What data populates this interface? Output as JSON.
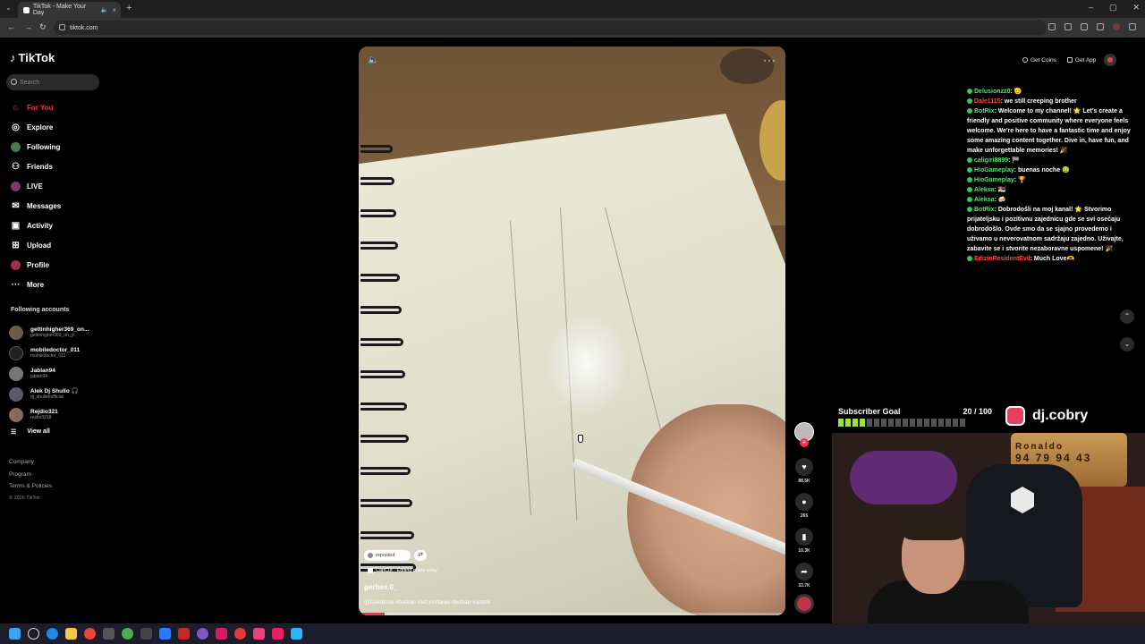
{
  "browser": {
    "tab_title": "TikTok - Make Your Day",
    "url": "tiktok.com"
  },
  "sidebar": {
    "logo": "TikTok",
    "search_placeholder": "Search",
    "nav": [
      {
        "label": "For You",
        "icon": "home-icon",
        "active": true
      },
      {
        "label": "Explore",
        "icon": "compass-icon"
      },
      {
        "label": "Following",
        "icon": "following-icon"
      },
      {
        "label": "Friends",
        "icon": "friends-icon"
      },
      {
        "label": "LIVE",
        "icon": "live-icon"
      },
      {
        "label": "Messages",
        "icon": "message-icon"
      },
      {
        "label": "Activity",
        "icon": "activity-icon"
      },
      {
        "label": "Upload",
        "icon": "upload-icon"
      },
      {
        "label": "Profile",
        "icon": "profile-icon"
      },
      {
        "label": "More",
        "icon": "more-icon"
      }
    ],
    "following_title": "Following accounts",
    "accounts": [
      {
        "name": "gettinhigher369_on...",
        "handle": "gettinhigher369_on_yt"
      },
      {
        "name": "mobiledoctor_011",
        "handle": "mobiledoctor_011"
      },
      {
        "name": "Jablan94",
        "handle": "jablan94"
      },
      {
        "name": "Alek Dj Shullo 🎧",
        "handle": "dj_shulleeofficial"
      },
      {
        "name": "Rejdio321",
        "handle": "rejdio3218"
      }
    ],
    "view_all": "View all",
    "footer": {
      "company": "Company",
      "program": "Program",
      "terms": "Terms & Policies",
      "copyright": "© 2026 TikTok"
    }
  },
  "video": {
    "repost_label": "reposted",
    "capcut_label": "CapCut · Editing made easy",
    "author": "gerbes.0_",
    "caption": "@Dekibmw #balkan #art #crtanje #boban #arttok",
    "progress": 0.06
  },
  "actions": {
    "likes": "88.5K",
    "comments": "265",
    "saves": "10.3K",
    "shares": "33.7K"
  },
  "topbar": {
    "get_coins": "Get Coins",
    "get_app": "Get App"
  },
  "chat": [
    {
      "user": "Delusionzz0",
      "text": ": 🫡",
      "color": "green"
    },
    {
      "user": "Dale1115",
      "text": ": we still creeping brother",
      "color": "red"
    },
    {
      "user": "BotRix",
      "text": ": Welcome to my channel! 🌟 Let's create a friendly and positive community where everyone feels welcome. We're here to have a fantastic time and enjoy some amazing content together. Dive in, have fun, and make unforgettable memories! 🎉",
      "color": "green"
    },
    {
      "user": "caligiri8899",
      "text": ": 🏁",
      "color": "green"
    },
    {
      "user": "HioGameplay",
      "text": ": buenas noche 🤢",
      "color": "green"
    },
    {
      "user": "HioGameplay",
      "text": ": 🏆",
      "color": "green"
    },
    {
      "user": "Aleksa",
      "text": ": 🇷🇸",
      "color": "green"
    },
    {
      "user": "Aleksa",
      "text": ": 🍻",
      "color": "green"
    },
    {
      "user": "BotRix",
      "text": ": Dobrodošli na moj kanal! 🌟 Stvorimo prijateljsku i pozitivnu zajednicu gde se svi osećaju dobrodošlo. Ovde smo da se sjajno provedemo i uživamo u neverovatnom sadržaju zajedno. Uživajte, zabavite se i stvorite nezaboravne uspomene! 🎉",
      "color": "green"
    },
    {
      "user": "EdizinResidentEvil",
      "text": ": Much Love🫶",
      "color": "red"
    }
  ],
  "overlay": {
    "subscriber_goal": "Subscriber Goal",
    "goal_count": "20 / 100",
    "goal_fraction": 0.2,
    "instagram_handle": "dj.cobry",
    "webcam_sign": "Ronaldo",
    "sign_stats": "94 79 94 43"
  },
  "colors": {
    "accent": "#fe2c55",
    "chat_green": "#5ee07a",
    "goal_green": "#9ee33a"
  }
}
